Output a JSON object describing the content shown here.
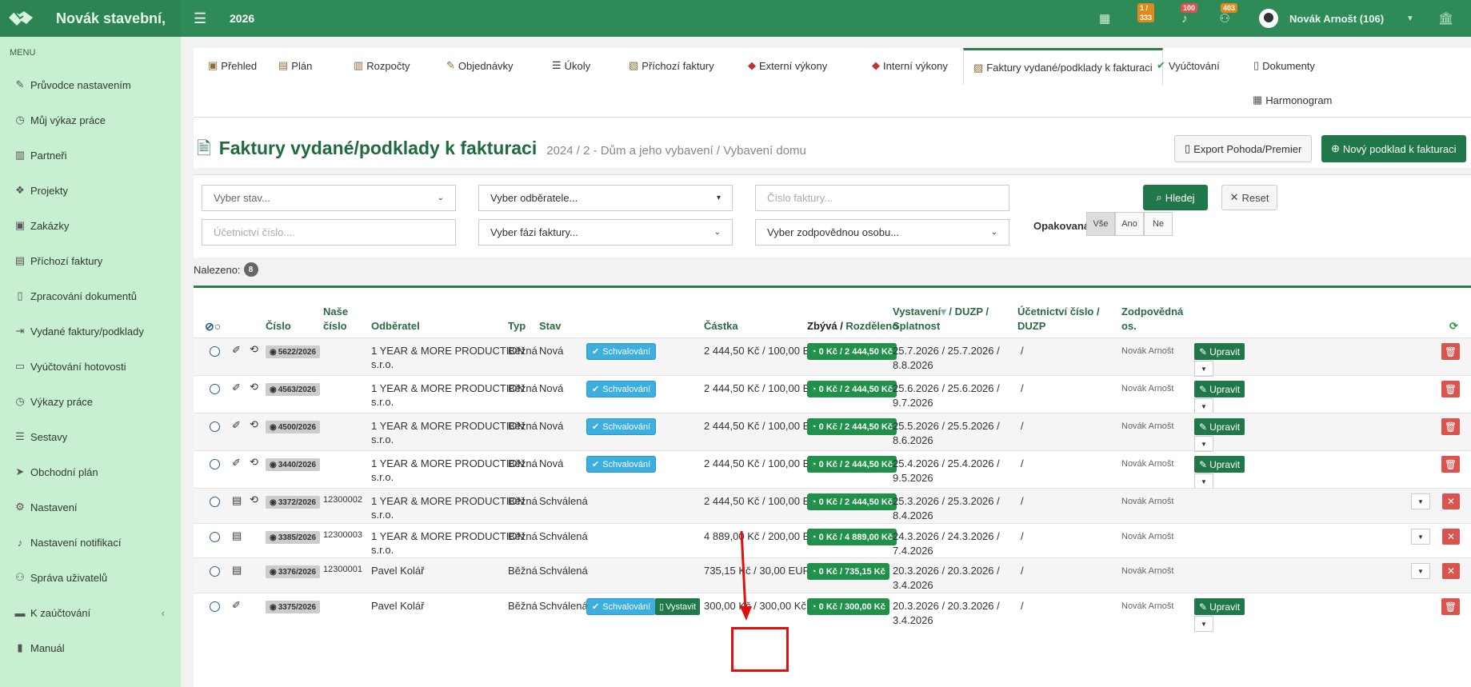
{
  "topbar": {
    "brand": "Novák stavební,",
    "year": "2026",
    "badges": {
      "tasks": "1 / 333",
      "bell": "100",
      "people": "403"
    },
    "user": "Novák Arnošt (106)",
    "icons": [
      "calendar-icon",
      "tasks-icon",
      "bell-icon",
      "people-icon",
      "bank-icon"
    ]
  },
  "sidebar": {
    "menu_label": "MENU",
    "items": [
      {
        "label": "Průvodce nastavením",
        "icon": "pencil-icon"
      },
      {
        "label": "Můj výkaz práce",
        "icon": "clock-icon"
      },
      {
        "label": "Partneři",
        "icon": "building-icon"
      },
      {
        "label": "Projekty",
        "icon": "cubes-icon"
      },
      {
        "label": "Zakázky",
        "icon": "box-icon"
      },
      {
        "label": "Příchozí faktury",
        "icon": "invoice-icon"
      },
      {
        "label": "Zpracování dokumentů",
        "icon": "document-icon"
      },
      {
        "label": "Vydané faktury/podklady",
        "icon": "export-icon"
      },
      {
        "label": "Vyúčtování hotovosti",
        "icon": "money-icon"
      },
      {
        "label": "Výkazy práce",
        "icon": "clock-icon"
      },
      {
        "label": "Sestavy",
        "icon": "list-icon"
      },
      {
        "label": "Obchodní plán",
        "icon": "send-icon"
      },
      {
        "label": "Nastavení",
        "icon": "cogs-icon"
      },
      {
        "label": "Nastavení notifikací",
        "icon": "bell-icon"
      },
      {
        "label": "Správa uživatelů",
        "icon": "users-icon"
      },
      {
        "label": "K zaúčtování",
        "icon": "folder-icon"
      },
      {
        "label": "Manuál",
        "icon": "book-icon"
      }
    ]
  },
  "tabs": [
    "Přehled",
    "Plán",
    "Rozpočty",
    "Objednávky",
    "Úkoly",
    "Příchozí faktury",
    "Externí výkony",
    "Interní výkony",
    "Faktury vydané/podklady k fakturaci",
    "Vyúčtování",
    "Dokumenty",
    "Harmonogram"
  ],
  "page": {
    "title": "Faktury vydané/podklady k fakturaci",
    "subtitle": "2024 / 2 - Dům a jeho vybavení / Vybavení domu",
    "export_label": "Export Pohoda/Premier",
    "new_label": "Nový podklad k fakturaci"
  },
  "filters": {
    "stav": "Vyber stav...",
    "odberatel": "Vyber odběratele...",
    "cislo_placeholder": "Číslo faktury...",
    "ucetni_placeholder": "Účetnictví číslo....",
    "faze": "Vyber fázi faktury...",
    "osoba": "Vyber zodpovědnou osobu...",
    "search": "Hledej",
    "reset": "Reset",
    "opakovana": "Opakovaná",
    "segments": [
      "Vše",
      "Ano",
      "Ne"
    ]
  },
  "found": {
    "label": "Nalezeno:",
    "count": "8"
  },
  "columns": {
    "cislo": "Číslo",
    "nase1": "Naše",
    "nase2": "číslo",
    "odberatel": "Odběratel",
    "typ": "Typ",
    "stav": "Stav",
    "castka": "Částka",
    "zbyva": "Zbývá",
    "sep": " / ",
    "rozdeleno": "Rozděleno",
    "vyst": "Vystavení",
    "duzp": " / DUZP /",
    "splatnost": "Splatnost",
    "ucet1": "Účetnictví číslo /",
    "ucet2": "DUZP",
    "zod1": "Zodpovědná",
    "zod2": "os."
  },
  "rows": [
    {
      "num": "5622/2026",
      "nase": "",
      "odb1": "1 YEAR & MORE PRODUCTION",
      "odb2": "s.r.o.",
      "typ": "Běžná",
      "stav": "Nová",
      "badge": "Schvalování",
      "vystavit": "",
      "castka": "2 444,50 Kč / 100,00 EUR",
      "zbyva": "0 Kč / 2 444,50 Kč",
      "d1": "25.7.2026 / 25.7.2026 /",
      "d2": "8.8.2026",
      "ucet": "/",
      "zod": "Novák Arnošt",
      "upravit": "Upravit"
    },
    {
      "num": "4563/2026",
      "nase": "",
      "odb1": "1 YEAR & MORE PRODUCTION",
      "odb2": "s.r.o.",
      "typ": "Běžná",
      "stav": "Nová",
      "badge": "Schvalování",
      "vystavit": "",
      "castka": "2 444,50 Kč / 100,00 EUR",
      "zbyva": "0 Kč / 2 444,50 Kč",
      "d1": "25.6.2026 / 25.6.2026 /",
      "d2": "9.7.2026",
      "ucet": "/",
      "zod": "Novák Arnošt",
      "upravit": "Upravit"
    },
    {
      "num": "4500/2026",
      "nase": "",
      "odb1": "1 YEAR & MORE PRODUCTION",
      "odb2": "s.r.o.",
      "typ": "Běžná",
      "stav": "Nová",
      "badge": "Schvalování",
      "vystavit": "",
      "castka": "2 444,50 Kč / 100,00 EUR",
      "zbyva": "0 Kč / 2 444,50 Kč",
      "d1": "25.5.2026 / 25.5.2026 /",
      "d2": "8.6.2026",
      "ucet": "/",
      "zod": "Novák Arnošt",
      "upravit": "Upravit"
    },
    {
      "num": "3440/2026",
      "nase": "",
      "odb1": "1 YEAR & MORE PRODUCTION",
      "odb2": "s.r.o.",
      "typ": "Běžná",
      "stav": "Nová",
      "badge": "Schvalování",
      "vystavit": "",
      "castka": "2 444,50 Kč / 100,00 EUR",
      "zbyva": "0 Kč / 2 444,50 Kč",
      "d1": "25.4.2026 / 25.4.2026 /",
      "d2": "9.5.2026",
      "ucet": "/",
      "zod": "Novák Arnošt",
      "upravit": "Upravit"
    },
    {
      "num": "3372/2026",
      "nase": "12300002",
      "odb1": "1 YEAR & MORE PRODUCTION",
      "odb2": "s.r.o.",
      "typ": "Běžná",
      "stav": "Schválená",
      "badge": "",
      "vystavit": "",
      "castka": "2 444,50 Kč / 100,00 EUR",
      "zbyva": "0 Kč / 2 444,50 Kč",
      "d1": "25.3.2026 / 25.3.2026 /",
      "d2": "8.4.2026",
      "ucet": "/",
      "zod": "Novák Arnošt",
      "upravit": ""
    },
    {
      "num": "3385/2026",
      "nase": "12300003",
      "odb1": "1 YEAR & MORE PRODUCTION",
      "odb2": "s.r.o.",
      "typ": "Běžná",
      "stav": "Schválená",
      "badge": "",
      "vystavit": "",
      "castka": "4 889,00 Kč / 200,00 EUR",
      "zbyva": "0 Kč / 4 889,00 Kč",
      "d1": "24.3.2026 / 24.3.2026 /",
      "d2": "7.4.2026",
      "ucet": "/",
      "zod": "Novák Arnošt",
      "upravit": ""
    },
    {
      "num": "3376/2026",
      "nase": "12300001",
      "odb1": "Pavel Kolář",
      "odb2": "",
      "typ": "Běžná",
      "stav": "Schválená",
      "badge": "",
      "vystavit": "",
      "castka": "735,15 Kč / 30,00 EUR",
      "zbyva": "0 Kč / 735,15 Kč",
      "d1": "20.3.2026 / 20.3.2026 /",
      "d2": "3.4.2026",
      "ucet": "/",
      "zod": "Novák Arnošt",
      "upravit": ""
    },
    {
      "num": "3375/2026",
      "nase": "",
      "odb1": "Pavel Kolář",
      "odb2": "",
      "typ": "Běžná",
      "stav": "Schválená",
      "badge": "Schvalování",
      "vystavit": "Vystavit",
      "castka": "300,00 Kč / 300,00 Kč",
      "zbyva": "0 Kč / 300,00 Kč",
      "d1": "20.3.2026 / 20.3.2026 /",
      "d2": "3.4.2026",
      "ucet": "/",
      "zod": "Novák Arnošt",
      "upravit": "Upravit"
    }
  ],
  "colors": {
    "green": "#2e8b57",
    "sidebar": "#c9efd2",
    "highlight": "#e01010"
  }
}
